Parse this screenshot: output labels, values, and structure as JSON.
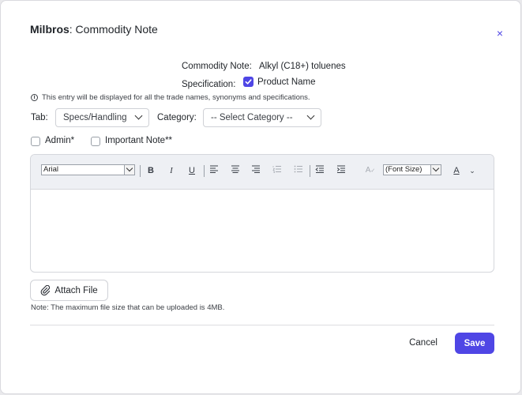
{
  "dialog": {
    "title_brand": "Milbros",
    "title_rest": ": Commodity Note",
    "close_glyph": "×"
  },
  "header_fields": {
    "commodity_note_label": "Commodity Note:",
    "commodity_note_value": "Alkyl (C18+) toluenes",
    "specification_label": "Specification:",
    "specification_option": "Product Name",
    "specification_checked": true
  },
  "info": {
    "text": "This entry will be displayed for all the trade names, synonyms and specifications.",
    "icon": "info-icon"
  },
  "tab_select": {
    "label": "Tab:",
    "value": "Specs/Handling"
  },
  "category_select": {
    "label": "Category:",
    "value": "-- Select Category --"
  },
  "checkboxes": {
    "admin": {
      "label": "Admin*",
      "checked": false
    },
    "important": {
      "label": "Important Note**",
      "checked": false
    }
  },
  "editor": {
    "font_family_value": "Arial",
    "font_size_value": "(Font Size)",
    "toolbar_icons": [
      "bold-icon",
      "italic-icon",
      "underline-icon",
      "align-left-icon",
      "align-center-icon",
      "align-right-icon",
      "ordered-list-icon",
      "unordered-list-icon",
      "outdent-icon",
      "indent-icon",
      "clear-format-icon",
      "font-color-icon",
      "chevron-down-icon"
    ],
    "content": ""
  },
  "attachment": {
    "button_label": "Attach File",
    "note": "Note: The maximum file size that can be uploaded is 4MB."
  },
  "footer": {
    "cancel_label": "Cancel",
    "save_label": "Save"
  },
  "colors": {
    "accent": "#4f46e5",
    "toolbar_bg": "#eef0f4",
    "border": "#d5d7dc"
  }
}
